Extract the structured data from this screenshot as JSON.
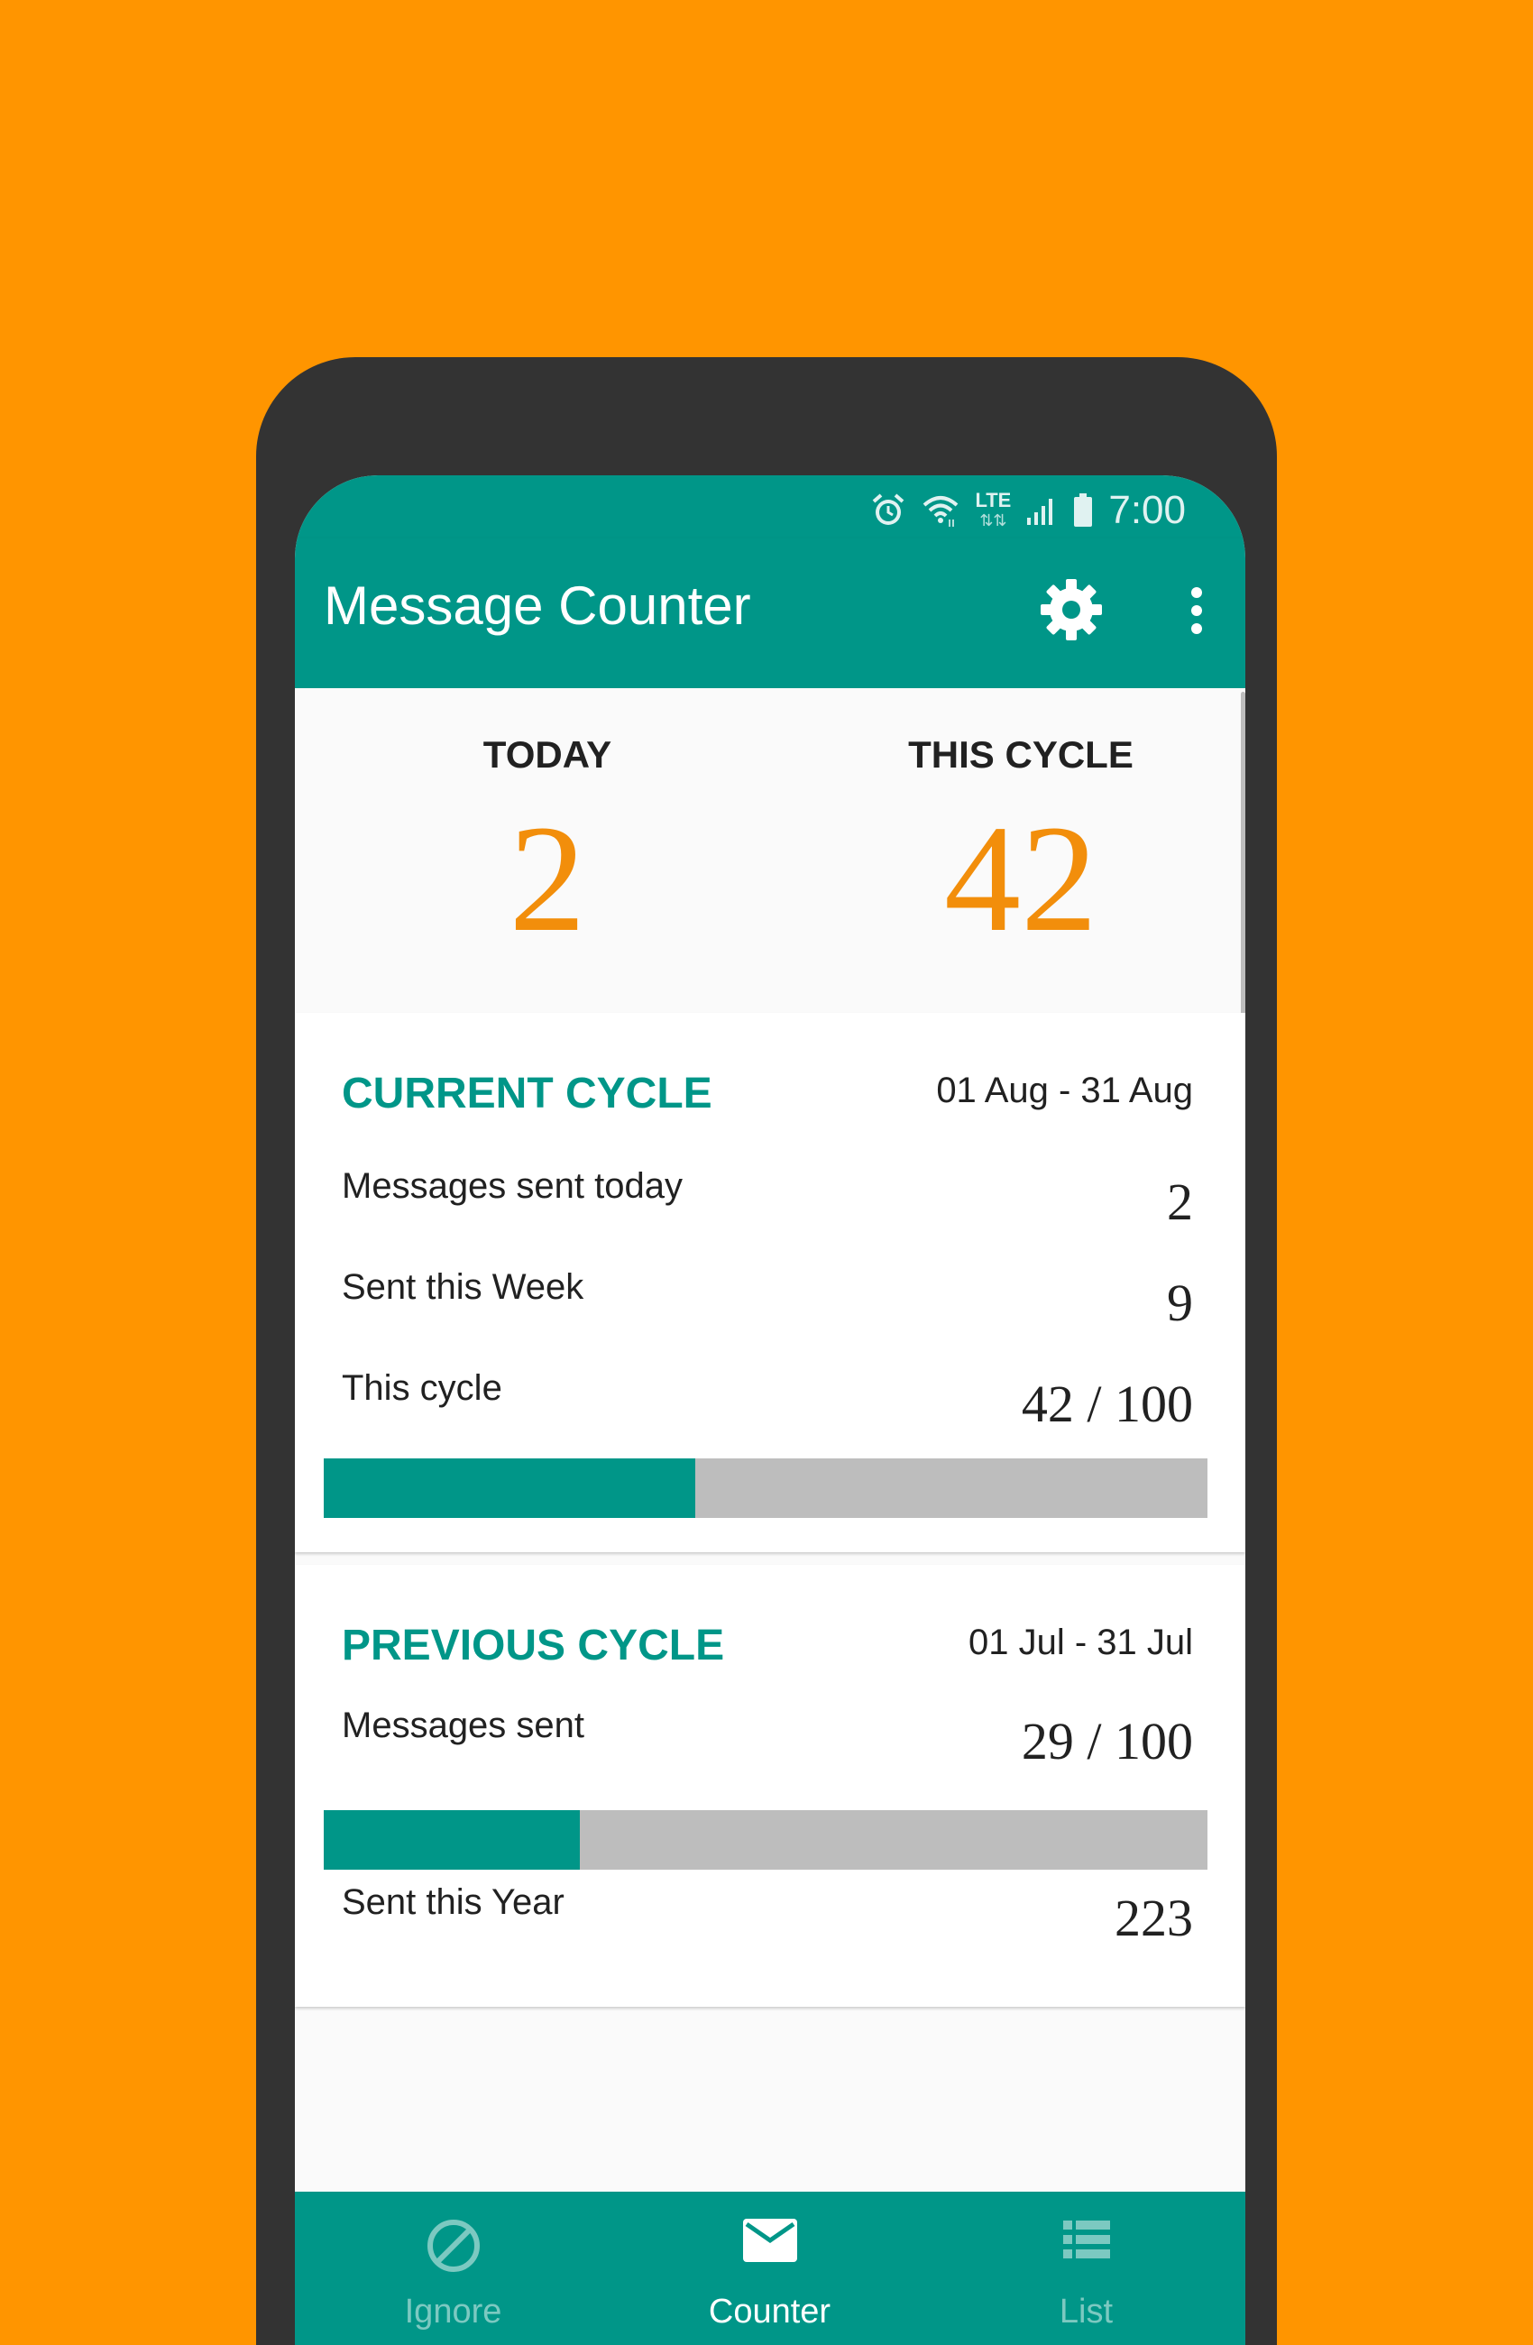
{
  "status_bar": {
    "time": "7:00",
    "icons": [
      "alarm-icon",
      "wifi-icon",
      "lte-icon",
      "signal-icon",
      "battery-icon"
    ],
    "lte_label": "LTE"
  },
  "app_bar": {
    "title": "Message Counter",
    "settings_icon": "gear-icon",
    "more_icon": "more-vert-icon"
  },
  "summary": {
    "today_label": "TODAY",
    "today_value": "2",
    "cycle_label": "THIS CYCLE",
    "cycle_value": "42"
  },
  "current_cycle": {
    "title": "CURRENT CYCLE",
    "range": "01 Aug - 31 Aug",
    "rows": [
      {
        "label": "Messages sent today",
        "value": "2"
      },
      {
        "label": "Sent this Week",
        "value": "9"
      },
      {
        "label": "This cycle",
        "value": "42 / 100"
      }
    ],
    "progress": 0.42
  },
  "previous_cycle": {
    "title": "PREVIOUS CYCLE",
    "range": "01 Jul - 31 Jul",
    "messages_label": "Messages sent",
    "messages_value": "29 / 100",
    "progress": 0.29,
    "year_label": "Sent this Year",
    "year_value": "223"
  },
  "bottom_nav": {
    "items": [
      {
        "label": "Ignore",
        "icon": "block-icon",
        "active": false
      },
      {
        "label": "Counter",
        "icon": "mail-icon",
        "active": true
      },
      {
        "label": "List",
        "icon": "list-icon",
        "active": false
      }
    ]
  },
  "colors": {
    "background": "#FF9500",
    "primary": "#009688",
    "accent": "#F28E0B",
    "progress_track": "#BDBDBD"
  }
}
